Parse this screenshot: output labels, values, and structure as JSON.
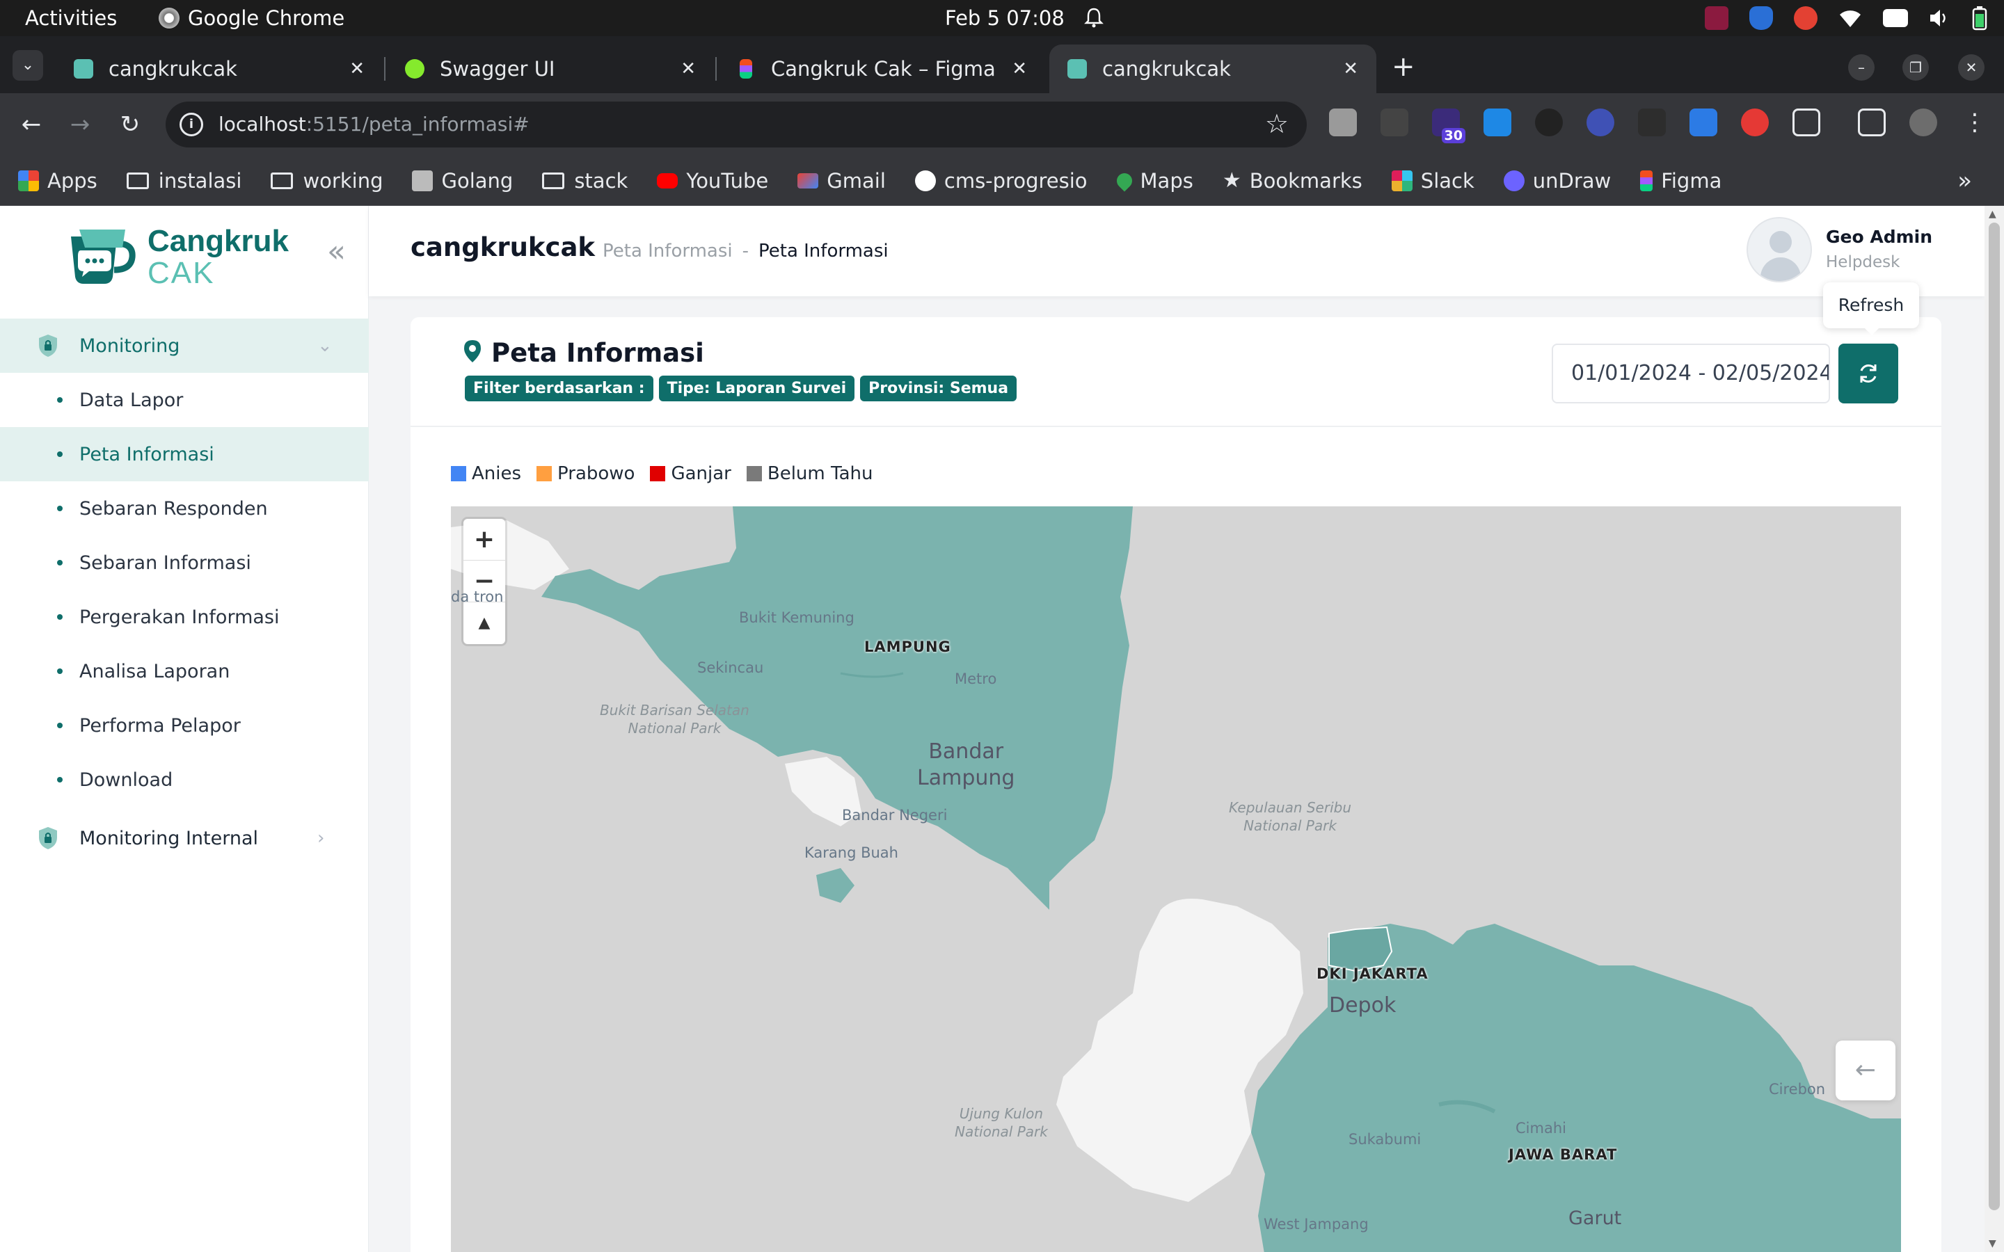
{
  "os": {
    "activities": "Activities",
    "app_name": "Google Chrome",
    "clock": "Feb 5  07:08"
  },
  "browser": {
    "tabs": [
      {
        "title": "cangkrukcak",
        "favicon_color": "#5bc0b3",
        "active": false
      },
      {
        "title": "Swagger UI",
        "favicon_color": "#85ea2d",
        "active": false
      },
      {
        "title": "Cangkruk Cak – Figma",
        "favicon_color": "#f24e1e",
        "active": false
      },
      {
        "title": "cangkrukcak",
        "favicon_color": "#5bc0b3",
        "active": true
      }
    ],
    "url_host": "localhost",
    "url_path": ":5151/peta_informasi#",
    "extension_badge": "30",
    "bookmarks": [
      {
        "label": "Apps",
        "icon": "apps-grid-icon"
      },
      {
        "label": "instalasi",
        "icon": "folder-icon"
      },
      {
        "label": "working",
        "icon": "folder-icon"
      },
      {
        "label": "Golang",
        "icon": "book-icon"
      },
      {
        "label": "stack",
        "icon": "folder-icon"
      },
      {
        "label": "YouTube",
        "icon": "youtube-icon"
      },
      {
        "label": "Gmail",
        "icon": "gmail-icon"
      },
      {
        "label": "cms-progresio",
        "icon": "site-icon"
      },
      {
        "label": "Maps",
        "icon": "maps-pin-icon"
      },
      {
        "label": "Bookmarks",
        "icon": "star-icon"
      },
      {
        "label": "Slack",
        "icon": "slack-icon"
      },
      {
        "label": "unDraw",
        "icon": "undraw-icon"
      },
      {
        "label": "Figma",
        "icon": "figma-icon"
      }
    ]
  },
  "sidebar": {
    "logo_line1": "Cangkruk",
    "logo_line2": "CAK",
    "groups": [
      {
        "label": "Monitoring",
        "open": true
      },
      {
        "label": "Monitoring Internal",
        "open": false
      }
    ],
    "items": [
      {
        "label": "Data Lapor",
        "active": false
      },
      {
        "label": "Peta Informasi",
        "active": true
      },
      {
        "label": "Sebaran Responden",
        "active": false
      },
      {
        "label": "Sebaran Informasi",
        "active": false
      },
      {
        "label": "Pergerakan Informasi",
        "active": false
      },
      {
        "label": "Analisa Laporan",
        "active": false
      },
      {
        "label": "Performa Pelapor",
        "active": false
      },
      {
        "label": "Download",
        "active": false
      }
    ]
  },
  "header": {
    "app_title": "cangkrukcak",
    "breadcrumb_parent": "Peta Informasi",
    "breadcrumb_sep": "-",
    "breadcrumb_current": "Peta Informasi",
    "user_name": "Geo Admin",
    "user_role": "Helpdesk"
  },
  "tooltip": "Refresh",
  "panel": {
    "title": "Peta Informasi",
    "chips": [
      "Filter berdasarkan :",
      "Tipe: Laporan Survei",
      "Provinsi: Semua"
    ],
    "date_range": "01/01/2024 - 02/05/2024",
    "legend": [
      {
        "label": "Anies",
        "color": "#4285f4"
      },
      {
        "label": "Prabowo",
        "color": "#ff9f40"
      },
      {
        "label": "Ganjar",
        "color": "#e00000"
      },
      {
        "label": "Belum Tahu",
        "color": "#7a7a7a"
      }
    ]
  },
  "map": {
    "province_fill": "#7bb3ae",
    "labels": {
      "lampung": "LAMPUNG",
      "dki": "DKI JAKARTA",
      "jabar": "JAWA BARAT",
      "bandar_lampung": "Bandar\nLampung",
      "depok": "Depok",
      "metro": "Metro",
      "bukit_kemuning": "Bukit Kemuning",
      "sekincau": "Sekincau",
      "bukit_barisan": "Bukit Barisan Selatan\nNational Park",
      "bandar_negeri": "Bandar Negeri",
      "karang_buah": "Karang Buah",
      "kepulauan_seribu": "Kepulauan Seribu\nNational Park",
      "ujung_kulon": "Ujung Kulon\nNational Park",
      "sukabumi": "Sukabumi",
      "cimahi": "Cimahi",
      "garut": "Garut",
      "cirebon": "Cirebon",
      "west_jampang": "West Jampang",
      "krui": "da    tron"
    }
  }
}
